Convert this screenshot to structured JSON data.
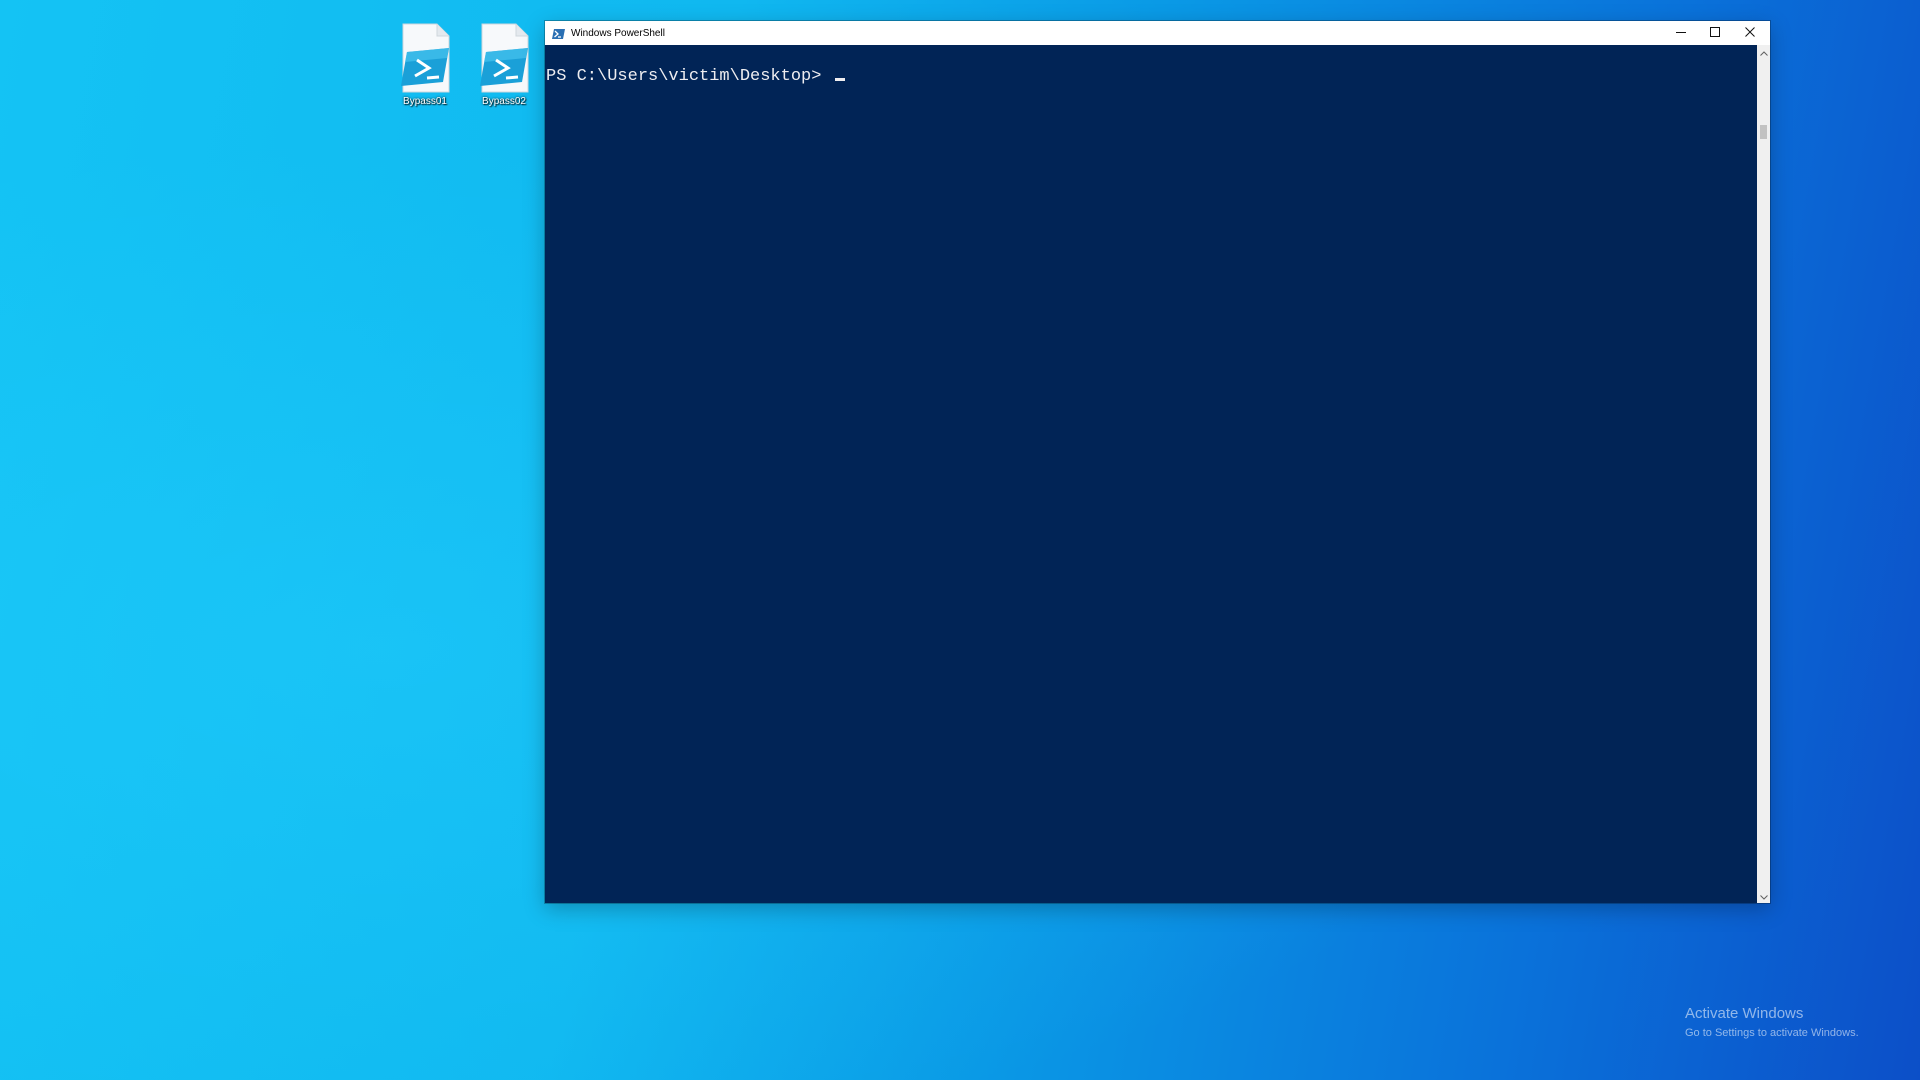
{
  "desktop": {
    "icons": [
      {
        "label": "Bypass01",
        "icon": "powershell-script-file-icon"
      },
      {
        "label": "Bypass02",
        "icon": "powershell-script-file-icon"
      }
    ],
    "watermark": {
      "title": "Activate Windows",
      "subtitle": "Go to Settings to activate Windows."
    }
  },
  "window": {
    "title": "Windows PowerShell",
    "app_icon": "powershell-icon",
    "controls": {
      "minimize_icon": "minimize-icon",
      "maximize_icon": "maximize-icon",
      "close_icon": "close-icon"
    }
  },
  "terminal": {
    "prompt": "PS C:\\Users\\victim\\Desktop> "
  },
  "colors": {
    "terminal_bg": "#012456",
    "terminal_fg": "#eeedf0",
    "desktop_accent": "#10b8f0"
  }
}
